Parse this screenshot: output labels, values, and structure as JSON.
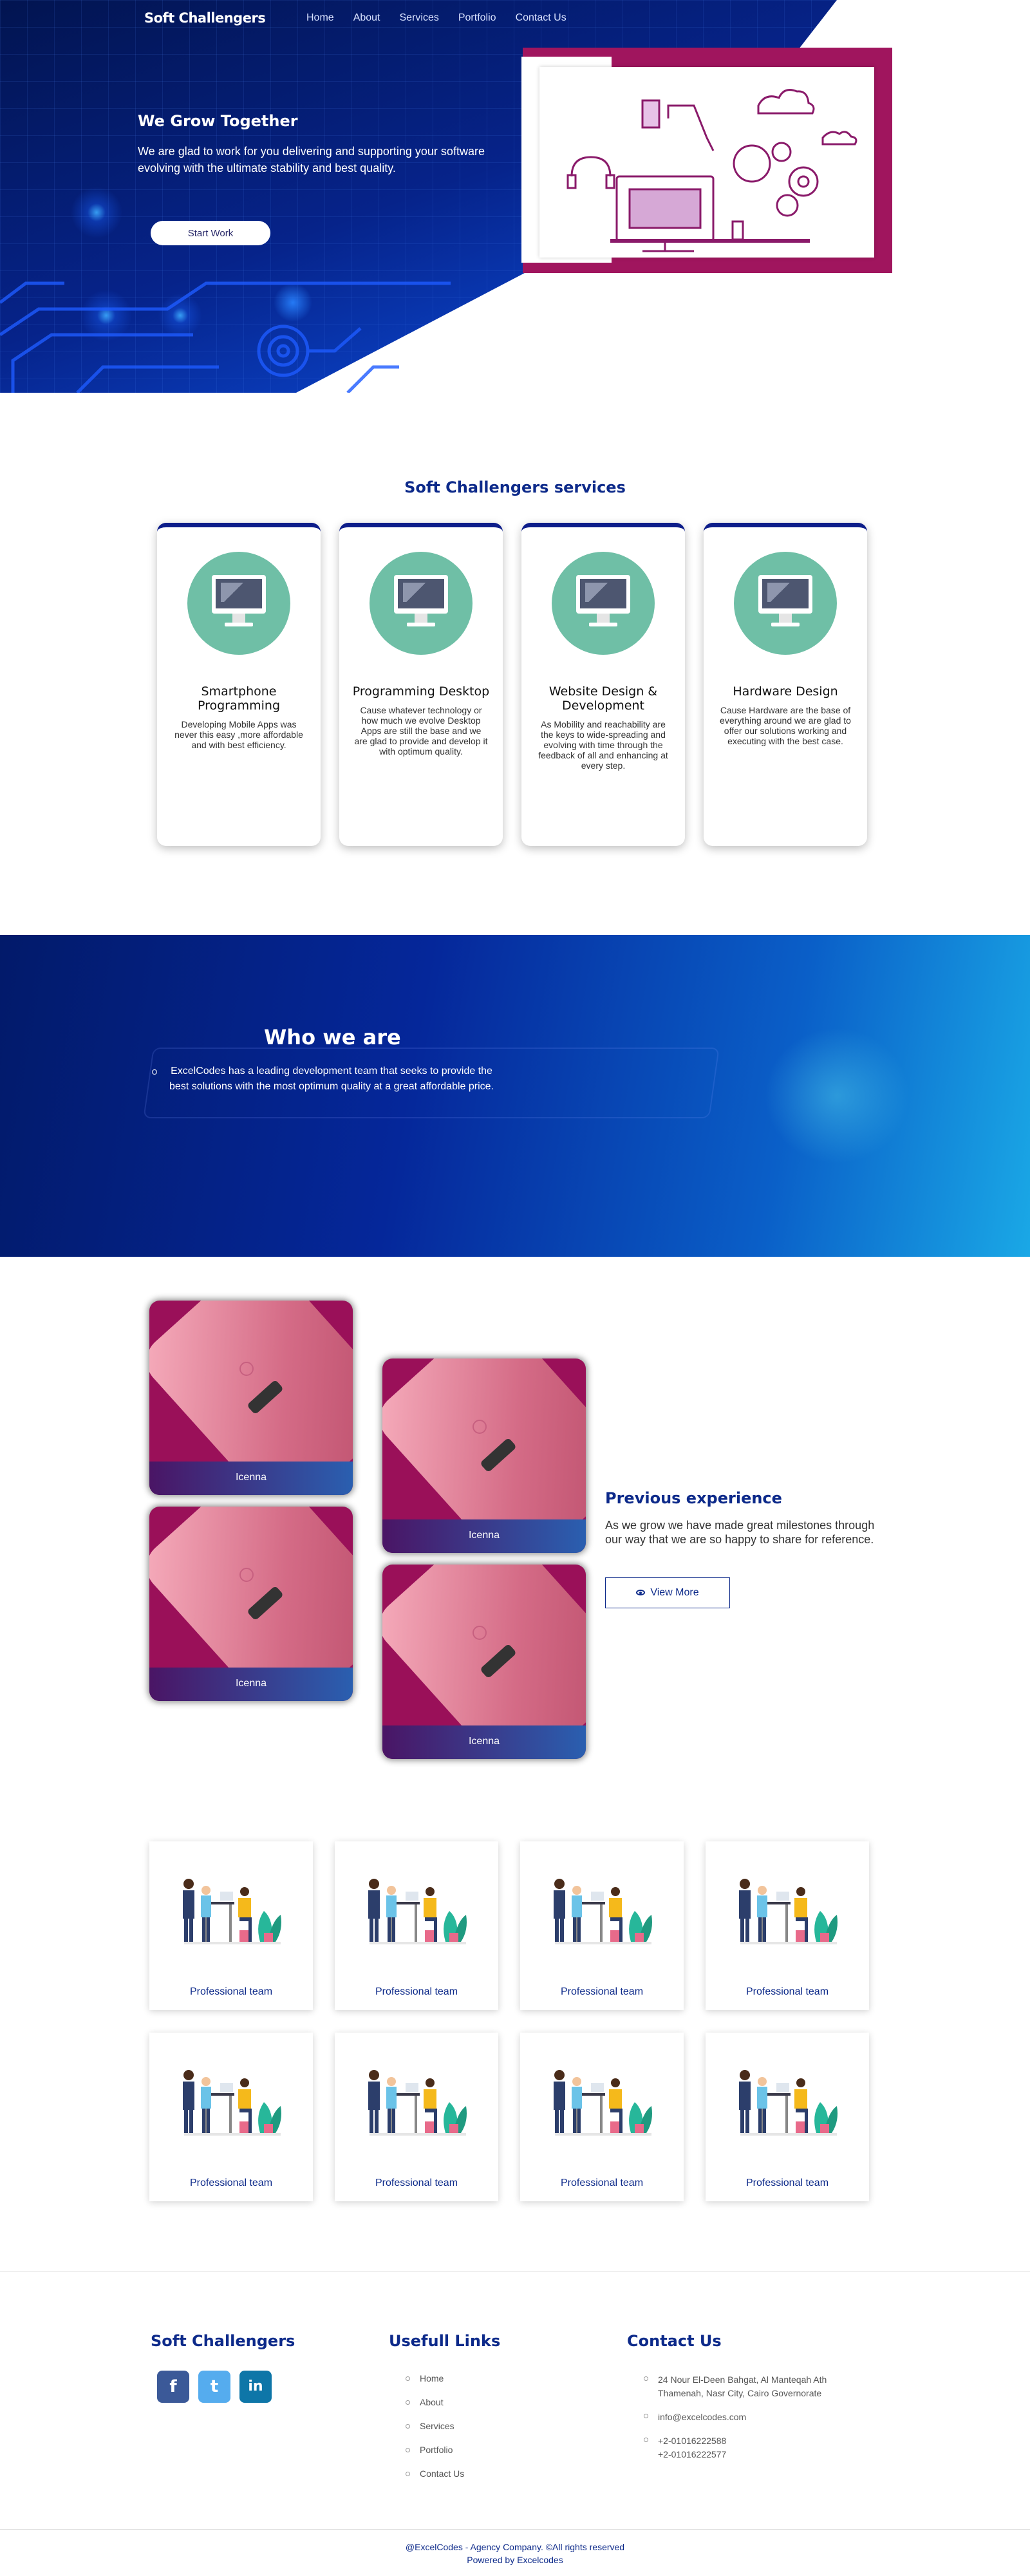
{
  "nav": {
    "brand": "Soft Challengers",
    "links": [
      "Home",
      "About",
      "Services",
      "Portfolio",
      "Contact Us"
    ]
  },
  "hero": {
    "title": "We Grow Together",
    "subtitle": "We are glad to work for you delivering and supporting your software evolving with the ultimate stability and best quality.",
    "cta": "Start Work"
  },
  "services": {
    "title": "Soft Challengers services",
    "items": [
      {
        "title": "Smartphone Programming",
        "text": "Developing Mobile Apps was never this easy ,more affordable and with best efficiency."
      },
      {
        "title": "Programming Desktop",
        "text": "Cause whatever technology or how much we evolve Desktop Apps are still the base and we are glad to provide and develop it with optimum quality."
      },
      {
        "title": "Website Design & Development",
        "text": "As Mobility and reachability are the keys to wide-spreading and evolving with time through the feedback of all and enhancing at every step."
      },
      {
        "title": "Hardware Design",
        "text": "Cause Hardware are the base of everything around we are glad to offer our solutions working and executing with the best case."
      }
    ]
  },
  "who": {
    "title": "Who we are",
    "text": "ExcelCodes has a leading development team that seeks to provide the best solutions with the most optimum quality at a great affordable price."
  },
  "portfolio": {
    "items": [
      "Icenna",
      "Icenna",
      "Icenna",
      "Icenna"
    ],
    "title": "Previous experience",
    "text": "As we grow we have made great milestones through our way that we are so happy to share for reference.",
    "button": "View More"
  },
  "team": {
    "items": [
      "Professional team",
      "Professional team",
      "Professional team",
      "Professional team",
      "Professional team",
      "Professional team",
      "Professional team",
      "Professional team"
    ]
  },
  "footer": {
    "brand": "Soft Challengers",
    "social": [
      "f",
      "t",
      "in"
    ],
    "links_title": "Usefull Links",
    "links": [
      "Home",
      "About",
      "Services",
      "Portfolio",
      "Contact Us"
    ],
    "contact_title": "Contact Us",
    "address": "24 Nour El-Deen Bahgat, Al Manteqah Ath Thamenah, Nasr City, Cairo Governorate",
    "email": "info@excelcodes.com",
    "phone1": "+2-01016222588",
    "phone2": "+2-01016222577",
    "copyright": "@ExcelCodes - Agency Company. ©All rights reserved",
    "powered": "Powered by Excelcodes"
  },
  "colors": {
    "primary": "#0d2a8a",
    "accent": "#a0155e",
    "service_icon_bg": "#6fbfa6",
    "facebook": "#3b5998",
    "twitter": "#55acee",
    "linkedin": "#0e76a8"
  }
}
